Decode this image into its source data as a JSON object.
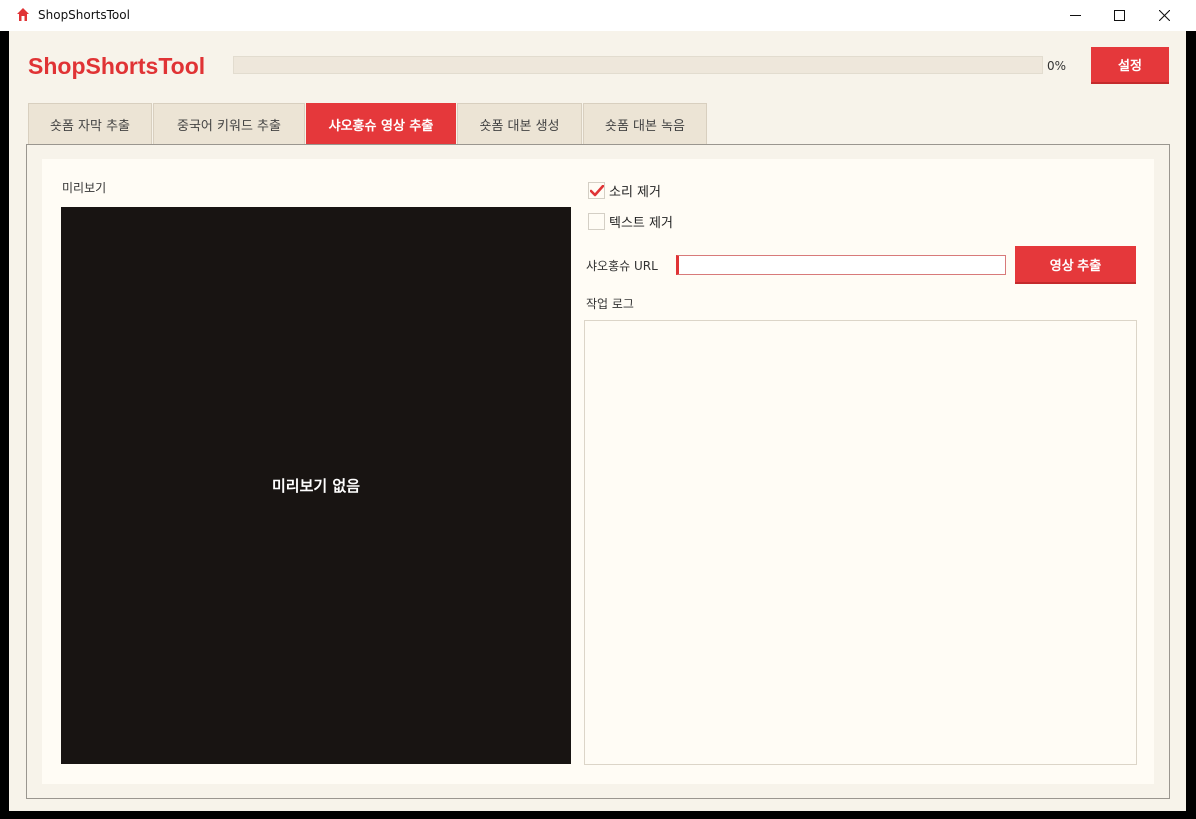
{
  "window": {
    "title": "ShopShortsTool",
    "controls": {
      "minimize": "minimize-icon",
      "maximize": "maximize-icon",
      "close": "close-icon"
    }
  },
  "header": {
    "brand": "ShopShortsTool",
    "progress": {
      "value": 0,
      "label": "0%"
    },
    "settings_label": "설정"
  },
  "tabs": [
    {
      "label": "숏폼 자막 추출",
      "active": false
    },
    {
      "label": "중국어 키워드 추출",
      "active": false
    },
    {
      "label": "샤오훙슈 영상 추출",
      "active": true
    },
    {
      "label": "숏폼 대본 생성",
      "active": false
    },
    {
      "label": "숏폼 대본 녹음",
      "active": false
    }
  ],
  "preview": {
    "label": "미리보기",
    "empty_text": "미리보기 없음"
  },
  "options": {
    "remove_sound": {
      "label": "소리 제거",
      "checked": true
    },
    "remove_text": {
      "label": "텍스트 제거",
      "checked": false
    }
  },
  "url": {
    "label": "샤오홍슈 URL",
    "value": "",
    "extract_label": "영상 추출"
  },
  "log": {
    "label": "작업 로그",
    "content": ""
  },
  "colors": {
    "accent": "#e5383b",
    "background": "#f7f3ea",
    "card": "#fffcf5",
    "preview_bg": "#181412"
  }
}
